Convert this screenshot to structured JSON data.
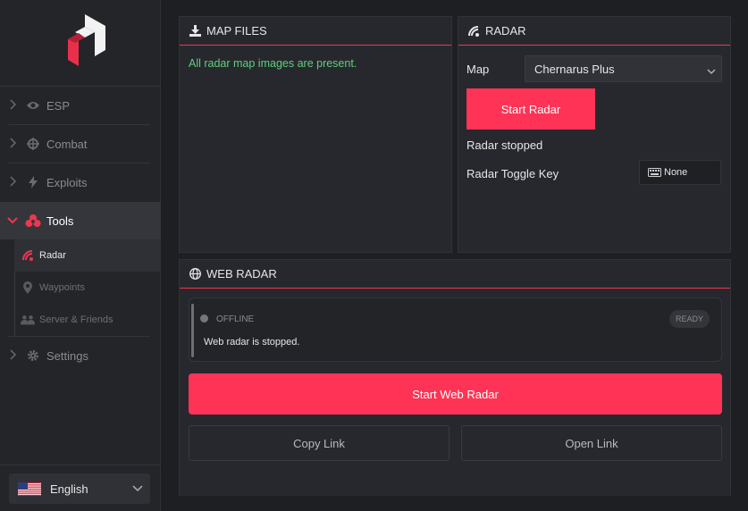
{
  "colors": {
    "accent": "#ff3355",
    "success": "#5fd07a",
    "background": "#1e1f23",
    "panel": "#27282d"
  },
  "sidebar": {
    "logo_icon": "app-logo",
    "items": [
      {
        "label": "ESP",
        "icon": "eye-icon",
        "expanded": false
      },
      {
        "label": "Combat",
        "icon": "crosshair-icon",
        "expanded": false
      },
      {
        "label": "Exploits",
        "icon": "bolt-icon",
        "expanded": false
      },
      {
        "label": "Tools",
        "icon": "tools-icon",
        "expanded": true
      },
      {
        "label": "Settings",
        "icon": "gear-icon",
        "expanded": false
      }
    ],
    "subitems": [
      {
        "label": "Radar",
        "icon": "radar-icon",
        "active": true
      },
      {
        "label": "Waypoints",
        "icon": "pin-icon",
        "active": false
      },
      {
        "label": "Server & Friends",
        "icon": "people-icon",
        "active": false
      }
    ],
    "language": {
      "label": "English",
      "icon": "us-flag-icon"
    }
  },
  "map_files": {
    "title": "MAP FILES",
    "icon": "download-icon",
    "status": "All radar map images are present."
  },
  "radar": {
    "title": "RADAR",
    "icon": "radar-icon",
    "map_label": "Map",
    "map_value": "Chernarus Plus",
    "start_button": "Start Radar",
    "status": "Radar stopped",
    "toggle_label": "Radar Toggle Key",
    "toggle_value": "None",
    "toggle_icon": "keyboard-icon"
  },
  "web_radar": {
    "title": "WEB RADAR",
    "icon": "globe-icon",
    "state": "OFFLINE",
    "badge": "READY",
    "message": "Web radar is stopped.",
    "start_button": "Start Web Radar",
    "copy_button": "Copy Link",
    "open_button": "Open Link"
  }
}
